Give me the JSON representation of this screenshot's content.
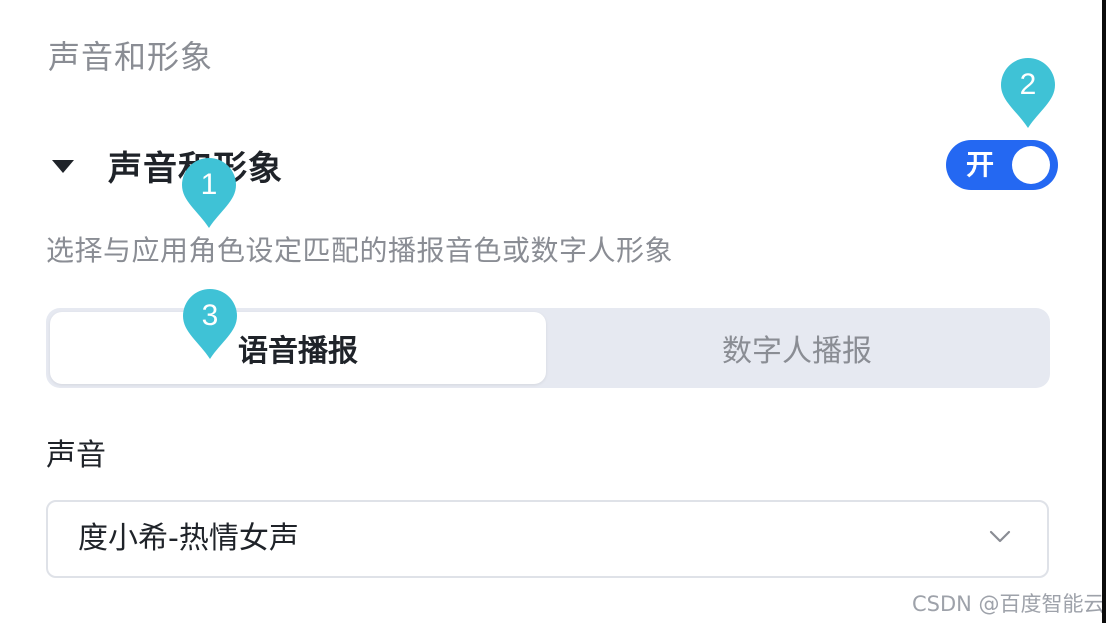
{
  "page_title": "声音和形象",
  "section": {
    "title": "声音和形象",
    "description": "选择与应用角色设定匹配的播报音色或数字人形象",
    "toggle": {
      "label": "开",
      "state": "on",
      "color": "#2468f2"
    }
  },
  "tabs": [
    {
      "label": "语音播报",
      "active": true
    },
    {
      "label": "数字人播报",
      "active": false
    }
  ],
  "voice": {
    "label": "声音",
    "selected": "度小希-热情女声"
  },
  "markers": [
    {
      "number": "1",
      "color": "#3fc2d6"
    },
    {
      "number": "2",
      "color": "#3fc2d6"
    },
    {
      "number": "3",
      "color": "#3fc2d6"
    }
  ],
  "watermark": "CSDN @百度智能云",
  "icons": {
    "caret": "caret-down-icon",
    "select": "chevron-down-icon"
  }
}
